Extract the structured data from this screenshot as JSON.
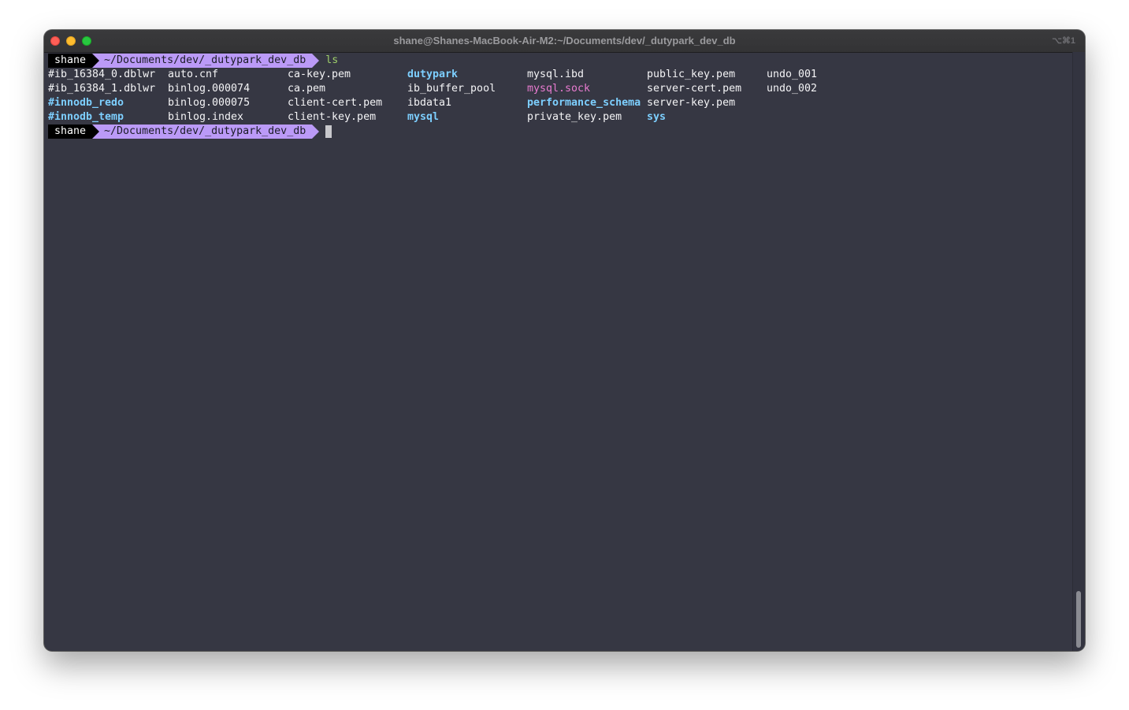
{
  "window": {
    "title": "shane@Shanes-MacBook-Air-M2:~/Documents/dev/_dutypark_dev_db",
    "shortcut": "⌥⌘1"
  },
  "prompt": {
    "user": "shane",
    "path": "~/Documents/dev/_dutypark_dev_db",
    "command": "ls"
  },
  "listing": {
    "rows": [
      [
        {
          "name": "#ib_16384_0.dblwr",
          "kind": "file"
        },
        {
          "name": "auto.cnf",
          "kind": "file"
        },
        {
          "name": "ca-key.pem",
          "kind": "file"
        },
        {
          "name": "dutypark",
          "kind": "dir"
        },
        {
          "name": "mysql.ibd",
          "kind": "file"
        },
        {
          "name": "public_key.pem",
          "kind": "file"
        },
        {
          "name": "undo_001",
          "kind": "file"
        }
      ],
      [
        {
          "name": "#ib_16384_1.dblwr",
          "kind": "file"
        },
        {
          "name": "binlog.000074",
          "kind": "file"
        },
        {
          "name": "ca.pem",
          "kind": "file"
        },
        {
          "name": "ib_buffer_pool",
          "kind": "file"
        },
        {
          "name": "mysql.sock",
          "kind": "socket"
        },
        {
          "name": "server-cert.pem",
          "kind": "file"
        },
        {
          "name": "undo_002",
          "kind": "file"
        }
      ],
      [
        {
          "name": "#innodb_redo",
          "kind": "dir"
        },
        {
          "name": "binlog.000075",
          "kind": "file"
        },
        {
          "name": "client-cert.pem",
          "kind": "file"
        },
        {
          "name": "ibdata1",
          "kind": "file"
        },
        {
          "name": "performance_schema",
          "kind": "dir"
        },
        {
          "name": "server-key.pem",
          "kind": "file"
        }
      ],
      [
        {
          "name": "#innodb_temp",
          "kind": "dir"
        },
        {
          "name": "binlog.index",
          "kind": "file"
        },
        {
          "name": "client-key.pem",
          "kind": "file"
        },
        {
          "name": "mysql",
          "kind": "dir"
        },
        {
          "name": "private_key.pem",
          "kind": "file"
        },
        {
          "name": "sys",
          "kind": "dir"
        }
      ]
    ]
  },
  "colors": {
    "background": "#363743",
    "directory": "#7dcfff",
    "socket": "#e87bd0",
    "command": "#9ece6a",
    "path_segment": "#bb9af7",
    "user_segment": "#000000"
  }
}
